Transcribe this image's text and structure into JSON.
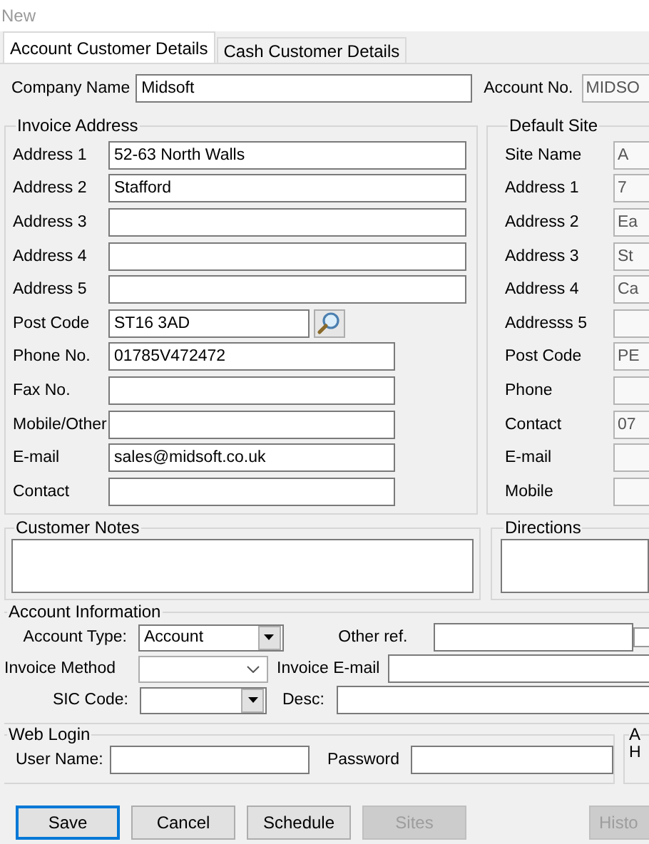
{
  "window": {
    "title": "New"
  },
  "tabs": [
    {
      "label": "Account Customer Details",
      "selected": true
    },
    {
      "label": "Cash Customer Details",
      "selected": false
    }
  ],
  "company_name": {
    "label": "Company Name",
    "value": "Midsoft"
  },
  "account_no": {
    "label": "Account No.",
    "value": "MIDSO",
    "readonly": true
  },
  "invoice_address": {
    "title": "Invoice Address",
    "fields": [
      {
        "label": "Address 1",
        "value": "52-63 North Walls",
        "kind": "wide"
      },
      {
        "label": "Address 2",
        "value": "Stafford",
        "kind": "wide"
      },
      {
        "label": "Address 3",
        "kind": "wide"
      },
      {
        "label": "Address 4",
        "kind": "wide"
      },
      {
        "label": "Address 5",
        "kind": "wide"
      },
      {
        "label": "Post Code",
        "value": "ST16 3AD",
        "kind": "lookup"
      },
      {
        "label": "Phone No.",
        "value": "01785V472472",
        "kind": "short"
      },
      {
        "label": "Fax No.",
        "kind": "short"
      },
      {
        "label": "Mobile/Other",
        "kind": "short"
      },
      {
        "label": "E-mail",
        "value": "sales@midsoft.co.uk",
        "kind": "short"
      },
      {
        "label": "Contact",
        "kind": "short"
      }
    ]
  },
  "default_site": {
    "title": "Default Site",
    "fields": [
      {
        "label": "Site Name",
        "value": "A"
      },
      {
        "label": "Address 1",
        "value": "7"
      },
      {
        "label": "Address 2",
        "value": "Ea"
      },
      {
        "label": "Address 3",
        "value": "St"
      },
      {
        "label": "Address 4",
        "value": "Ca"
      },
      {
        "label": "Addresss 5"
      },
      {
        "label": "Post Code",
        "value": "PE"
      },
      {
        "label": "Phone"
      },
      {
        "label": "Contact",
        "value": "07"
      },
      {
        "label": "E-mail"
      },
      {
        "label": "Mobile"
      }
    ]
  },
  "customer_notes": {
    "title": "Customer Notes"
  },
  "directions": {
    "title": "Directions"
  },
  "account_information": {
    "title": "Account Information",
    "account_type": {
      "label": "Account Type:",
      "value": "Account"
    },
    "other_ref": {
      "label": "Other ref."
    },
    "checkbox": {
      "checked": false
    },
    "invoice_method": {
      "label": "Invoice Method"
    },
    "invoice_email": {
      "label": "Invoice E-mail"
    },
    "sic_code": {
      "label": "SIC Code:"
    },
    "desc": {
      "label": "Desc:"
    }
  },
  "web_login": {
    "title": "Web Login",
    "user_name": {
      "label": "User Name:"
    },
    "password": {
      "label": "Password"
    }
  },
  "group_3": {
    "title": "A",
    "label": "H"
  },
  "buttons": [
    {
      "label": "Save",
      "disabled": false,
      "focused": true
    },
    {
      "label": "Cancel",
      "disabled": false,
      "focused": false
    },
    {
      "label": "Schedule",
      "disabled": false,
      "focused": false
    },
    {
      "label": "Sites",
      "disabled": true,
      "focused": false
    }
  ],
  "button_5": {
    "label": "Histo",
    "disabled": true
  }
}
